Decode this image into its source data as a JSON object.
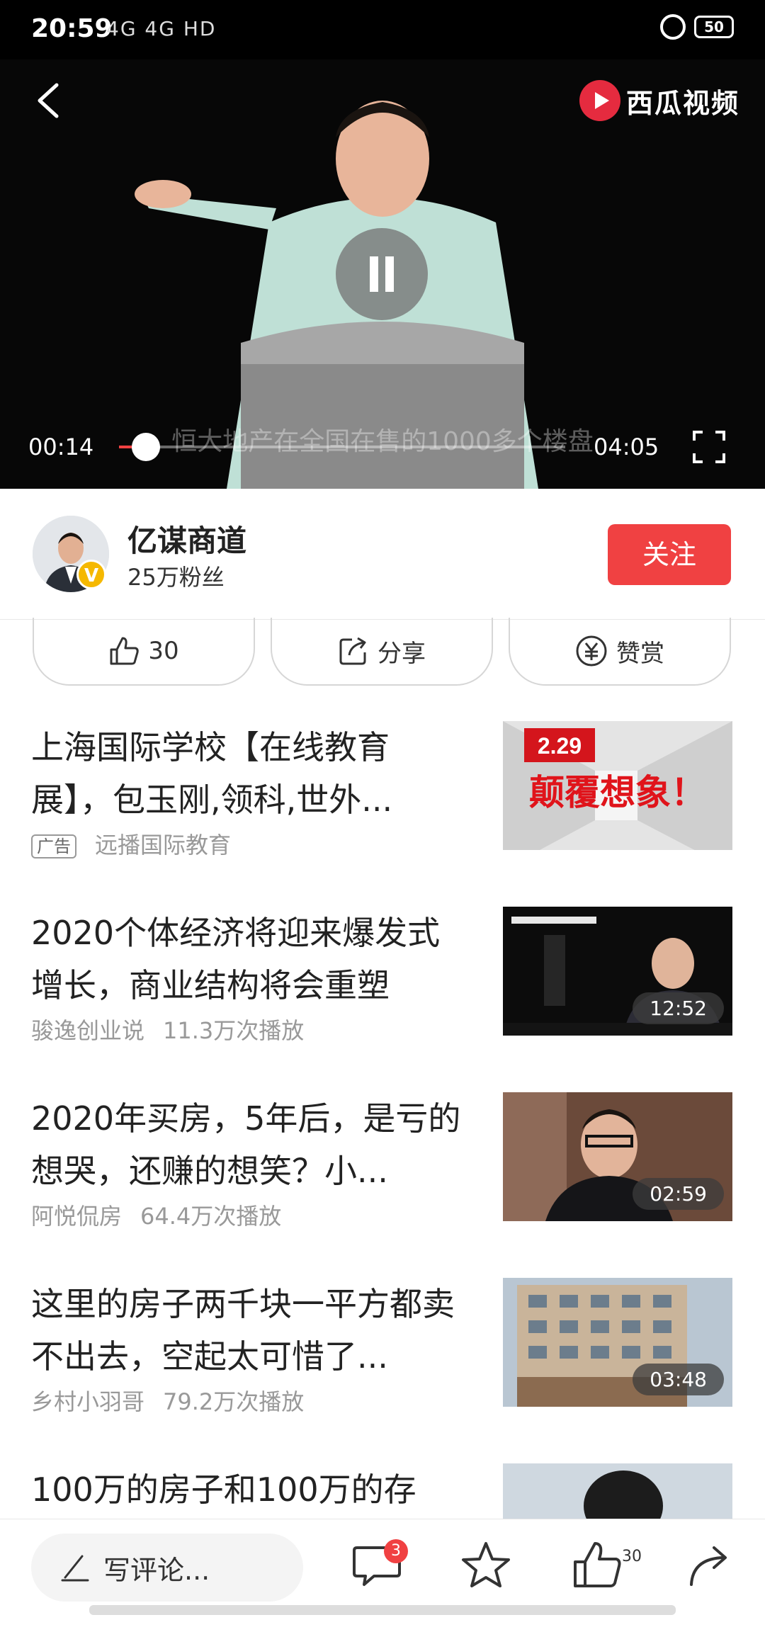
{
  "status_bar": {
    "time": "20:59",
    "network": "4G 4G HD",
    "battery": "50"
  },
  "player": {
    "brand": "西瓜视频",
    "subtitle": "恒大地产在全国在售的1000多个楼盘",
    "current_time": "00:14",
    "duration": "04:05",
    "progress": 0.06,
    "accent": "#f04142"
  },
  "author": {
    "name": "亿谋商道",
    "fans": "25万粉丝",
    "verified_mark": "V",
    "follow_label": "关注"
  },
  "actions": {
    "like_count": "30",
    "share_label": "分享",
    "reward_label": "赞赏"
  },
  "feed": [
    {
      "title": "上海国际学校【在线教育展】，包玉刚,领科,世外...",
      "ad_tag": "广告",
      "source": "远播国际教育",
      "views": "",
      "duration": "",
      "thumb_badge": "2.29",
      "thumb_text": "颠覆想象！"
    },
    {
      "title": "2020个体经济将迎来爆发式增长，商业结构将会重塑",
      "ad_tag": "",
      "source": "骏逸创业说",
      "views": "11.3万次播放",
      "duration": "12:52"
    },
    {
      "title": "2020年买房，5年后，是亏的想哭，还赚的想笑？小...",
      "ad_tag": "",
      "source": "阿悦侃房",
      "views": "64.4万次播放",
      "duration": "02:59"
    },
    {
      "title": "这里的房子两千块一平方都卖不出去，空起太可惜了...",
      "ad_tag": "",
      "source": "乡村小羽哥",
      "views": "79.2万次播放",
      "duration": "03:48"
    },
    {
      "title": "100万的房子和100万的存",
      "ad_tag": "",
      "source": "",
      "views": "",
      "duration": ""
    }
  ],
  "bottom_bar": {
    "comment_placeholder": "写评论...",
    "comment_count": "3",
    "like_count": "30"
  }
}
